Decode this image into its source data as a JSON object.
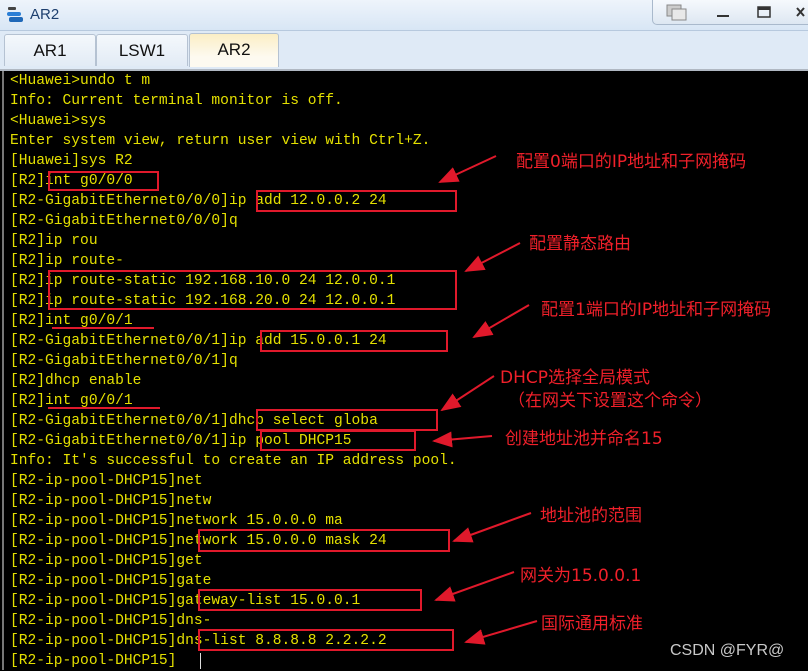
{
  "window": {
    "title": "AR2",
    "controls": [
      "restore-view",
      "minimize",
      "maximize",
      "close"
    ]
  },
  "tabs": [
    {
      "label": "AR1",
      "active": false
    },
    {
      "label": "LSW1",
      "active": false
    },
    {
      "label": "AR2",
      "active": true
    }
  ],
  "terminal": {
    "colors": {
      "text": "#e4e000",
      "background": "#000000",
      "annotation": "#f0202a"
    },
    "lines": [
      "<Huawei>undo t m",
      "Info: Current terminal monitor is off.",
      "<Huawei>sys",
      "Enter system view, return user view with Ctrl+Z.",
      "[Huawei]sys R2",
      "[R2]int g0/0/0",
      "[R2-GigabitEthernet0/0/0]ip add 12.0.0.2 24",
      "[R2-GigabitEthernet0/0/0]q",
      "[R2]ip rou",
      "[R2]ip route-",
      "[R2]ip route-static 192.168.10.0 24 12.0.0.1",
      "[R2]ip route-static 192.168.20.0 24 12.0.0.1",
      "[R2]int g0/0/1",
      "[R2-GigabitEthernet0/0/1]ip add 15.0.0.1 24",
      "[R2-GigabitEthernet0/0/1]q",
      "[R2]dhcp enable",
      "[R2]int g0/0/1",
      "[R2-GigabitEthernet0/0/1]dhcp select globa",
      "[R2-GigabitEthernet0/0/1]ip pool DHCP15",
      "Info: It's successful to create an IP address pool.",
      "[R2-ip-pool-DHCP15]net",
      "[R2-ip-pool-DHCP15]netw",
      "[R2-ip-pool-DHCP15]network 15.0.0.0 ma",
      "[R2-ip-pool-DHCP15]network 15.0.0.0 mask 24",
      "[R2-ip-pool-DHCP15]get",
      "[R2-ip-pool-DHCP15]gate",
      "[R2-ip-pool-DHCP15]gateway-list 15.0.0.1",
      "[R2-ip-pool-DHCP15]dns-",
      "[R2-ip-pool-DHCP15]dns-list 8.8.8.8 2.2.2.2",
      "[R2-ip-pool-DHCP15]"
    ]
  },
  "annotations": [
    "配置0端口的IP地址和子网掩码",
    "配置静态路由",
    "配置1端口的IP地址和子网掩码",
    "DHCP选择全局模式",
    "（在网关下设置这个命令）",
    "创建地址池并命名15",
    "地址池的范围",
    "网关为15.0.0.1",
    "国际通用标准"
  ],
  "watermark": "CSDN @FYR@"
}
